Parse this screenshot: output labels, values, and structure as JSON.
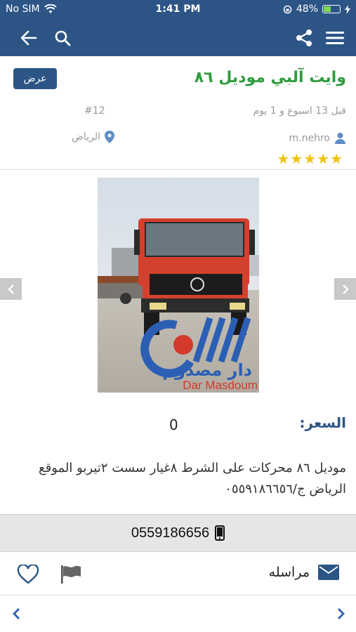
{
  "status": {
    "carrier": "No SIM",
    "time": "1:41 PM",
    "battery": "48%",
    "battery_level": 0.48
  },
  "nav": {
    "back_icon": "arrow-left-icon",
    "search_icon": "search-icon",
    "share_icon": "share-icon",
    "menu_icon": "hamburger-menu-icon"
  },
  "listing": {
    "title": "وايت آلبي موديل ٨٦",
    "badge": "عرض",
    "posted": "قبل 13 اسبوع و 1 يوم",
    "id": "#12",
    "user": "m.nehro",
    "location": "الرياض",
    "stars": "★★★★★",
    "rating": 5
  },
  "image": {
    "watermark_brand": "دار مصدوم",
    "watermark_latin": "Dar Masdoum"
  },
  "price": {
    "label": "السعر:",
    "value": "0"
  },
  "description": {
    "line1": "موديل ٨٦ محركات على الشرط ٨غيار سست ٢تيربو الموقع",
    "line2": "الرياض ج/٠٥٥٩١٨٦٦٥٦"
  },
  "contact": {
    "phone": "0559186656"
  },
  "actions": {
    "message_label": "مراسله"
  },
  "colors": {
    "primary": "#2c5586",
    "title_green": "#2e9b3e",
    "star": "#f2c20a"
  }
}
